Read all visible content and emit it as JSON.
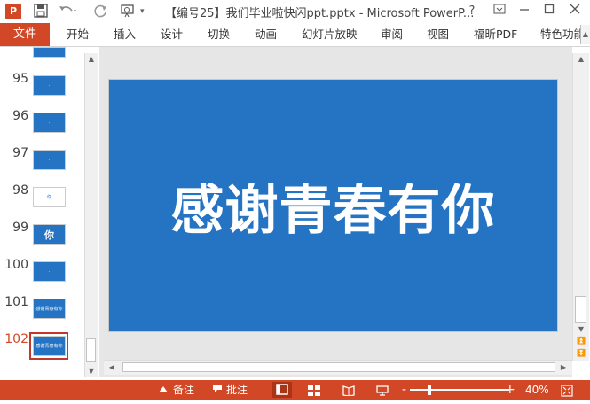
{
  "titlebar": {
    "app_icon": "P",
    "title": "【编号25】我们毕业啦快闪ppt.pptx - Microsoft PowerP...",
    "help": "?",
    "icons": [
      "save-icon",
      "undo-icon",
      "redo-icon",
      "start-from-beginning-icon",
      "ribbon-display-icon",
      "minimize-icon",
      "maximize-icon",
      "close-icon"
    ]
  },
  "ribbon": {
    "file": "文件",
    "tabs": [
      "开始",
      "插入",
      "设计",
      "切换",
      "动画",
      "幻灯片放映",
      "审阅",
      "视图",
      "福昕PDF",
      "特色功能"
    ]
  },
  "thumbnails": [
    {
      "num": "95",
      "text": "·",
      "style": "blue"
    },
    {
      "num": "96",
      "text": "·",
      "style": "blue"
    },
    {
      "num": "97",
      "text": "·",
      "style": "blue"
    },
    {
      "num": "98",
      "text": "你",
      "style": "white"
    },
    {
      "num": "99",
      "text": "你",
      "style": "blue"
    },
    {
      "num": "100",
      "text": "·",
      "style": "blue"
    },
    {
      "num": "101",
      "text": "感谢青春有你",
      "style": "blue"
    },
    {
      "num": "102",
      "text": "感谢青春有你",
      "style": "blue",
      "active": true
    }
  ],
  "slide": {
    "text": "感谢青春有你",
    "background": "#2574c4"
  },
  "statusbar": {
    "notes": "备注",
    "comments": "批注",
    "zoom_minus": "-",
    "zoom_plus": "+",
    "zoom": "40%",
    "zoom_level": 0.4
  },
  "colors": {
    "accent": "#d24726",
    "slide_blue": "#2574c4"
  }
}
